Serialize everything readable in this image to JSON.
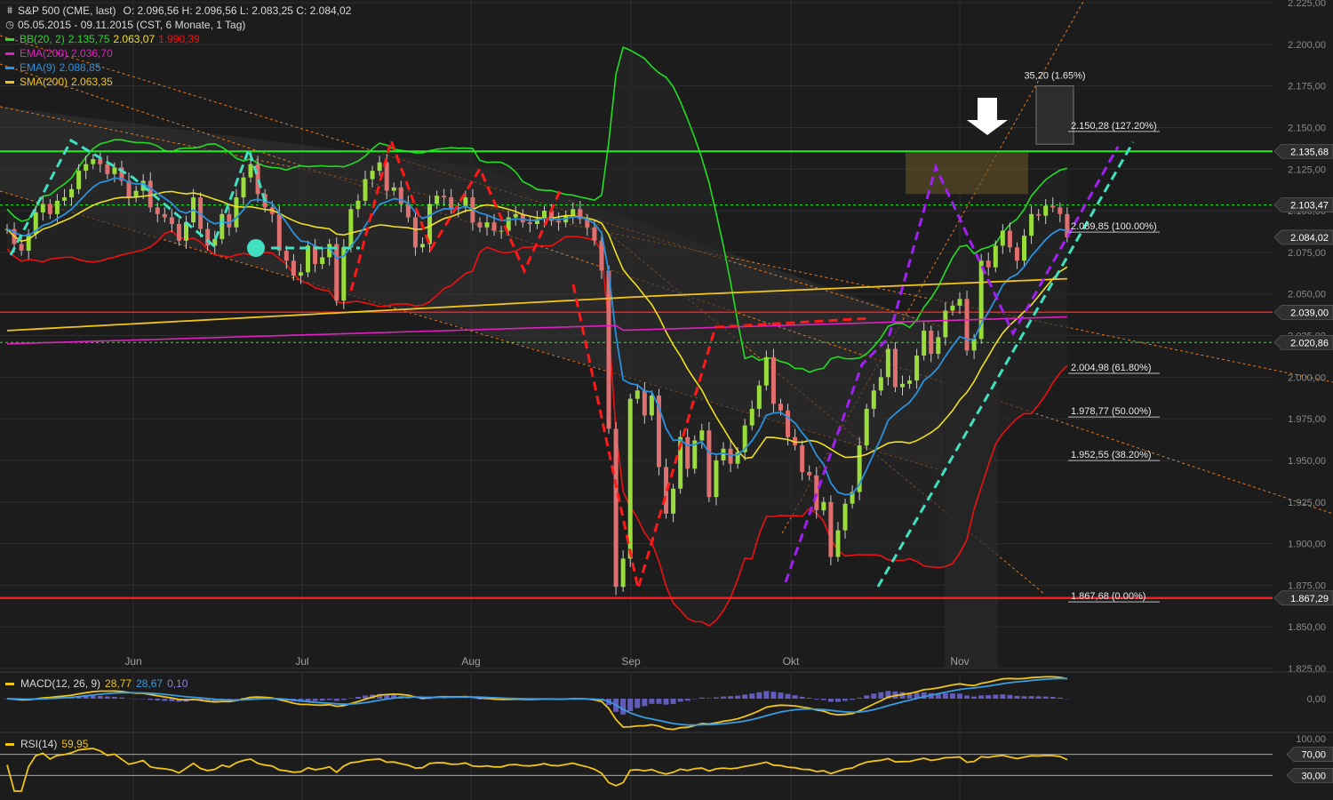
{
  "header": {
    "title": "S&P 500 (CME, last)",
    "ohlc": "O: 2.096,56  H: 2.096,56  L: 2.083,25  C: 2.084,02",
    "range": "05.05.2015 - 09.11.2015 (CST, 6 Monate, 1 Tag)"
  },
  "legend": [
    {
      "label": "BB(20, 2)",
      "color": "#22dd22",
      "values": [
        {
          "text": "2.135,75",
          "color": "#22dd22"
        },
        {
          "text": "2.063,07",
          "color": "#f0e020"
        },
        {
          "text": "1.990,39",
          "color": "#ee1111"
        }
      ]
    },
    {
      "label": "EMA(200)",
      "color": "#e020c0",
      "values": [
        {
          "text": "2.036,70",
          "color": "#e020c0"
        }
      ]
    },
    {
      "label": "EMA(9)",
      "color": "#2a90e0",
      "values": [
        {
          "text": "2.088,85",
          "color": "#2a90e0"
        }
      ]
    },
    {
      "label": "SMA(200)",
      "color": "#f0c419",
      "values": [
        {
          "text": "2.063,35",
          "color": "#f0c419"
        }
      ]
    }
  ],
  "colors": {
    "bg": "#1c1c1c",
    "grid": "#2e2e2e",
    "bull": "#9adc3c",
    "bear": "#e07070",
    "red": "#ff1a1a",
    "green": "#22ee22",
    "cyan": "#40e0c0",
    "purple": "#a020f0",
    "orange": "#e07a20"
  },
  "chart_data": {
    "type": "candlestick",
    "ylim": [
      1825,
      2225
    ],
    "x_tick_labels": [
      "Jun",
      "Jul",
      "Aug",
      "Sep",
      "Okt",
      "Nov"
    ],
    "y_tick_labels": [
      "2.225,00",
      "2.200,00",
      "2.175,00",
      "2.150,00",
      "2.125,00",
      "2.100,00",
      "2.075,00",
      "2.050,00",
      "2.025,00",
      "2.000,00",
      "1.975,00",
      "1.950,00",
      "1.925,00",
      "1.900,00",
      "1.875,00",
      "1.850,00",
      "1.825,00"
    ],
    "y_tick_values": [
      2225,
      2200,
      2175,
      2150,
      2125,
      2100,
      2075,
      2050,
      2025,
      2000,
      1975,
      1950,
      1925,
      1900,
      1875,
      1850,
      1825
    ],
    "close": [
      2089,
      2080,
      2076,
      2086,
      2099,
      2104,
      2098,
      2106,
      2108,
      2113,
      2124,
      2128,
      2131,
      2128,
      2122,
      2126,
      2118,
      2108,
      2112,
      2118,
      2102,
      2098,
      2096,
      2092,
      2082,
      2093,
      2108,
      2089,
      2079,
      2083,
      2098,
      2090,
      2108,
      2120,
      2128,
      2110,
      2102,
      2098,
      2076,
      2070,
      2061,
      2063,
      2079,
      2068,
      2072,
      2080,
      2046,
      2078,
      2101,
      2106,
      2119,
      2124,
      2129,
      2112,
      2114,
      2104,
      2096,
      2078,
      2080,
      2104,
      2109,
      2108,
      2101,
      2102,
      2108,
      2093,
      2090,
      2093,
      2088,
      2088,
      2096,
      2098,
      2093,
      2092,
      2095,
      2100,
      2094,
      2093,
      2097,
      2101,
      2095,
      2090,
      2082,
      2064,
      1969,
      1874,
      1891,
      1987,
      1992,
      1977,
      1989,
      1946,
      1918,
      1933,
      1964,
      1945,
      1962,
      1968,
      1928,
      1950,
      1957,
      1948,
      1955,
      1971,
      1981,
      1995,
      2012,
      1984,
      1980,
      1964,
      1959,
      1943,
      1941,
      1920,
      1925,
      1892,
      1908,
      1924,
      1931,
      1959,
      1981,
      1992,
      2000,
      2017,
      1994,
      1996,
      1998,
      2013,
      2028,
      2014,
      2024,
      2040,
      2043,
      2047,
      2016,
      2023,
      2070,
      2066,
      2079,
      2088,
      2078,
      2070,
      2085,
      2098,
      2097,
      2103,
      2102,
      2098,
      2084
    ]
  },
  "price_labels": [
    {
      "text": "2.135,68",
      "color": "#ffffff",
      "bg": "#303030",
      "y": 2135.68
    },
    {
      "text": "2.103,47",
      "color": "#ffffff",
      "bg": "#303030",
      "y": 2103.47
    },
    {
      "text": "2.084,02",
      "color": "#ffffff",
      "bg": "#303030",
      "y": 2084.02
    },
    {
      "text": "2.039,00",
      "color": "#ffffff",
      "bg": "#303030",
      "y": 2039.0
    },
    {
      "text": "2.020,86",
      "color": "#ffffff",
      "bg": "#303030",
      "y": 2020.86
    },
    {
      "text": "1.867,29",
      "color": "#ffffff",
      "bg": "#303030",
      "y": 1867.29
    }
  ],
  "fib_levels": [
    {
      "text": "2.150,28 (127.20%)",
      "y": 2150.28
    },
    {
      "text": "2.089,85 (100.00%)",
      "y": 2089.85
    },
    {
      "text": "2.004,98 (61.80%)",
      "y": 2004.98
    },
    {
      "text": "1.978,77 (50.00%)",
      "y": 1978.77
    },
    {
      "text": "1.952,55 (38.20%)",
      "y": 1952.55
    },
    {
      "text": "1.867,68 (0.00%)",
      "y": 1867.68
    }
  ],
  "measure_label": "35,20 (1.65%)",
  "macd": {
    "label": "MACD(12, 26, 9)",
    "v1": "28,77",
    "v2": "28,67",
    "v3": "0,10",
    "tick": "0,00"
  },
  "rsi": {
    "label": "RSI(14)",
    "value": "59,95",
    "ticks": [
      "100,00",
      "70,00",
      "30,00"
    ]
  }
}
